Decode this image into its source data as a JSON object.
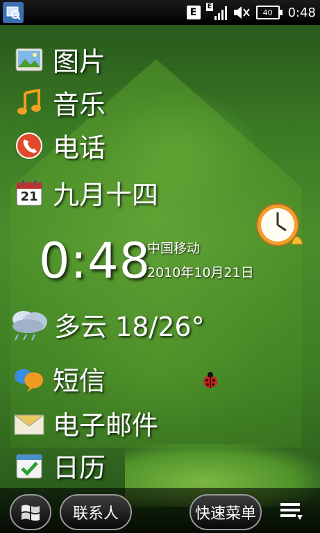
{
  "status_bar": {
    "edge_badge": "E",
    "signal_edge_badge": "E",
    "battery_label": "40",
    "time": "0:48"
  },
  "menu": [
    {
      "label": "图片",
      "icon": "pictures-icon"
    },
    {
      "label": "音乐",
      "icon": "music-note-icon"
    },
    {
      "label": "电话",
      "icon": "phone-icon"
    },
    {
      "label": "九月十四",
      "icon": "calendar-21-icon",
      "icon_day": "21"
    }
  ],
  "clock": {
    "time": "0:48",
    "carrier": "中国移动",
    "date": "2010年10月21日"
  },
  "weather": {
    "label": "多云 18/26°",
    "icon": "cloudy-rain-icon"
  },
  "menu2": [
    {
      "label": "短信",
      "icon": "sms-bubbles-icon"
    },
    {
      "label": "电子邮件",
      "icon": "email-envelope-icon"
    },
    {
      "label": "日历",
      "icon": "calendar-check-icon"
    }
  ],
  "bottom_bar": {
    "contacts_label": "联系人",
    "quick_menu_label": "快速菜单"
  },
  "colors": {
    "accent_green": "#4a8d2c",
    "bar_black": "#000000",
    "text_white": "#ffffff"
  }
}
